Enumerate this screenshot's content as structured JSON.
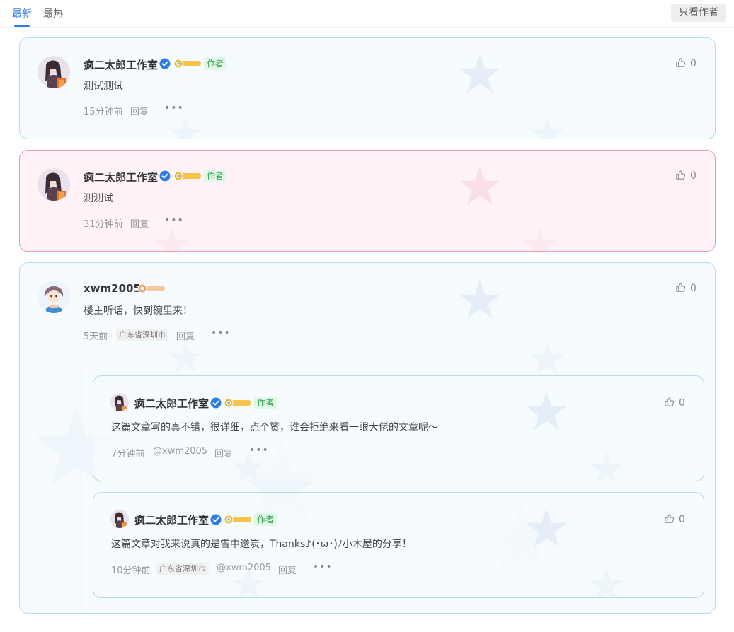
{
  "tabs": {
    "latest": "最新",
    "hottest": "最热"
  },
  "author_only_label": "只看作者",
  "colors": {
    "accent": "#2f7de1",
    "blue_border": "#b3dcf1",
    "pink_border": "#ee9ab7",
    "author_green": "#2ea44f"
  },
  "comments": [
    {
      "user": "疯二太郎工作室",
      "verified": true,
      "level": "LV6",
      "author_badge": "作者",
      "text": "测试测试",
      "time": "15分钟前",
      "reply": "回复",
      "likes": "0",
      "theme": "blue"
    },
    {
      "user": "疯二太郎工作室",
      "verified": true,
      "level": "LV6",
      "author_badge": "作者",
      "text": "测测试",
      "time": "31分钟前",
      "reply": "回复",
      "likes": "0",
      "theme": "pink"
    },
    {
      "user": "xwm2005",
      "verified": false,
      "level": "LV3",
      "text": "楼主听话，快到碗里来！",
      "time": "5天前",
      "location": "广东省深圳市",
      "reply": "回复",
      "likes": "0",
      "theme": "blue",
      "replies": [
        {
          "user": "疯二太郎工作室",
          "verified": true,
          "level": "LV6",
          "author_badge": "作者",
          "text": "这篇文章写的真不错，很详细，点个赞，谁会拒绝来看一眼大佬的文章呢～",
          "time": "7分钟前",
          "mention": "@xwm2005",
          "reply": "回复",
          "likes": "0"
        },
        {
          "user": "疯二太郎工作室",
          "verified": true,
          "level": "LV6",
          "author_badge": "作者",
          "text": "这篇文章对我来说真的是雪中送炭，Thanks♪(･ω･)ﾉ小木屋的分享！",
          "time": "10分钟前",
          "location": "广东省深圳市",
          "mention": "@xwm2005",
          "reply": "回复",
          "likes": "0"
        }
      ]
    }
  ]
}
